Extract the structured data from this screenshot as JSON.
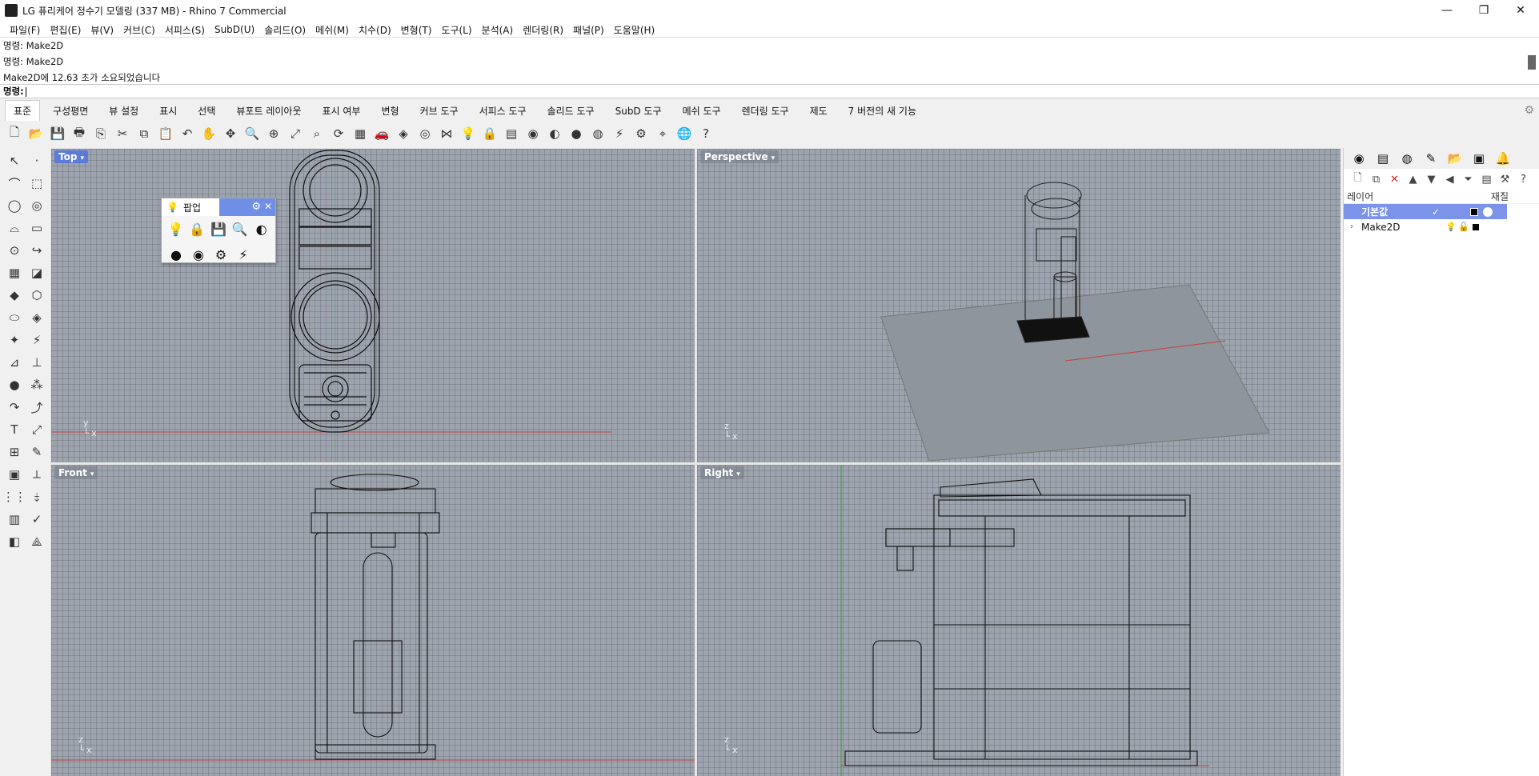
{
  "window": {
    "title": "LG 퓨리케어 정수기 모델링 (337 MB) - Rhino 7 Commercial",
    "minimize": "—",
    "restore": "❐",
    "close": "✕"
  },
  "menu": [
    "파일(F)",
    "편집(E)",
    "뷰(V)",
    "커브(C)",
    "서피스(S)",
    "SubD(U)",
    "솔리드(O)",
    "메쉬(M)",
    "치수(D)",
    "변형(T)",
    "도구(L)",
    "분석(A)",
    "렌더링(R)",
    "패널(P)",
    "도움말(H)"
  ],
  "command_history": [
    "명령: Make2D",
    "명령: Make2D",
    "Make2D에 12.63 초가 소요되었습니다"
  ],
  "command_prompt": "명령:",
  "tabs": [
    "표준",
    "구성평면",
    "뷰 설정",
    "표시",
    "선택",
    "뷰포트 레이아웃",
    "표시 여부",
    "변형",
    "커브 도구",
    "서피스 도구",
    "솔리드 도구",
    "SubD 도구",
    "메쉬 도구",
    "렌더링 도구",
    "제도",
    "7 버전의 새 기능"
  ],
  "toolbar_icons": [
    "new-icon",
    "open-icon",
    "save-icon",
    "print-icon",
    "import-icon",
    "cut-icon",
    "copy-icon",
    "paste-icon",
    "undo-icon",
    "pan-icon",
    "move-view-icon",
    "zoom-icon",
    "zoom-window-icon",
    "zoom-extents-icon",
    "zoom-selected-icon",
    "rotate-view-icon",
    "four-view-icon",
    "car-icon",
    "named-cplane-icon",
    "named-view-icon",
    "snap-icon",
    "light-bulb-icon",
    "lock-icon",
    "layer-icon",
    "color-wheel-icon",
    "shaded-sphere-icon",
    "rendered-sphere-icon",
    "material-sphere-icon",
    "render-flash-icon",
    "gear-options-icon",
    "osnap-icon",
    "globe-icon",
    "help-icon"
  ],
  "toolbar_glyphs": [
    "🗋",
    "📂",
    "💾",
    "🖶",
    "⎘",
    "✂",
    "⧉",
    "📋",
    "↶",
    "✋",
    "✥",
    "🔍",
    "⊕",
    "⤢",
    "⌕",
    "⟳",
    "▦",
    "🚗",
    "◈",
    "◎",
    "⋈",
    "💡",
    "🔒",
    "▤",
    "◉",
    "◐",
    "●",
    "◍",
    "⚡",
    "⚙",
    "⌖",
    "🌐",
    "?"
  ],
  "left_tools": [
    "↖",
    "·",
    "⌒",
    "⬚",
    "◯",
    "◎",
    "⌓",
    "▭",
    "⊙",
    "↪",
    "▦",
    "◪",
    "◆",
    "⬡",
    "⬭",
    "◈",
    "✦",
    "⚡",
    "⊿",
    "⊥",
    "●",
    "⁂",
    "↷",
    "⤴",
    "T",
    "⤢",
    "⊞",
    "✎",
    "▣",
    "⟂",
    "⋮⋮",
    "⤈",
    "▥",
    "✓",
    "◧",
    "⟁"
  ],
  "viewports": {
    "top": {
      "label": "Top",
      "axis": "y\n└ x"
    },
    "perspective": {
      "label": "Perspective",
      "axis": "z"
    },
    "front": {
      "label": "Front",
      "axis": "z"
    },
    "right": {
      "label": "Right",
      "axis": "z"
    }
  },
  "popup": {
    "title": "팝업",
    "icons_row1": [
      "💡",
      "🔒",
      "💾",
      "🔍",
      "◐"
    ],
    "icons_row2": [
      "●",
      "◉",
      "⚙",
      "⚡"
    ]
  },
  "right_panel": {
    "tab_icons": [
      "◉",
      "▤",
      "◍",
      "✎",
      "📂",
      "▣",
      "🔔"
    ],
    "tool_icons": [
      "🗋",
      "⧉",
      "✕",
      "▲",
      "▼",
      "◀",
      "⏷",
      "▤",
      "⚒",
      "?"
    ],
    "header_layer": "레이어",
    "header_material": "재질",
    "layers": [
      {
        "name": "기본값",
        "check": "✓",
        "selected": true
      },
      {
        "name": "Make2D",
        "check": "",
        "selected": false
      }
    ]
  },
  "colors": {
    "viewport_bg": "#9da4ae",
    "active_label": "#5c7bd9",
    "selected_layer": "#7b93e8"
  }
}
